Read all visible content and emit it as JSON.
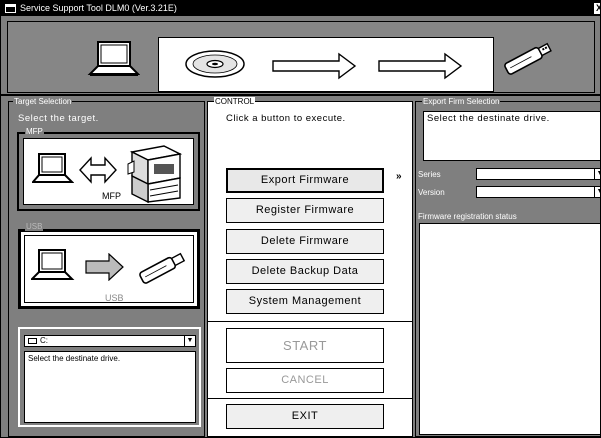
{
  "window": {
    "title": "Service Support Tool DLM0 (Ver.3.21E)",
    "close_glyph": "X"
  },
  "banner": {
    "icons": [
      "laptop-icon",
      "disc-icon",
      "arrow-right-icon",
      "arrow-right-icon",
      "usb-drive-icon"
    ]
  },
  "target_selection": {
    "label": "Target Selection",
    "hint": "Select the target.",
    "mfp": {
      "label": "MFP",
      "caption": "MFP"
    },
    "usb": {
      "label": "USB",
      "caption": "USB"
    },
    "drive": {
      "value": "C:",
      "message": "Select the destinate drive."
    }
  },
  "control": {
    "label": "CONTROL",
    "hint": "Click a button to execute.",
    "buttons": {
      "export_firmware": "Export Firmware",
      "register_firmware": "Register Firmware",
      "delete_firmware": "Delete Firmware",
      "delete_backup_data": "Delete Backup Data",
      "system_management": "System Management",
      "start": "START",
      "cancel": "CANCEL",
      "exit": "EXIT"
    },
    "selected_indicator": "»"
  },
  "export_selection": {
    "label": "Export Firm Selection",
    "message": "Select the destinate drive.",
    "series_label": "Series",
    "version_label": "Version",
    "status_label": "Firmware registration status"
  },
  "colors": {
    "panel_gray": "#7f7f7f",
    "title_bar": "#000000"
  }
}
